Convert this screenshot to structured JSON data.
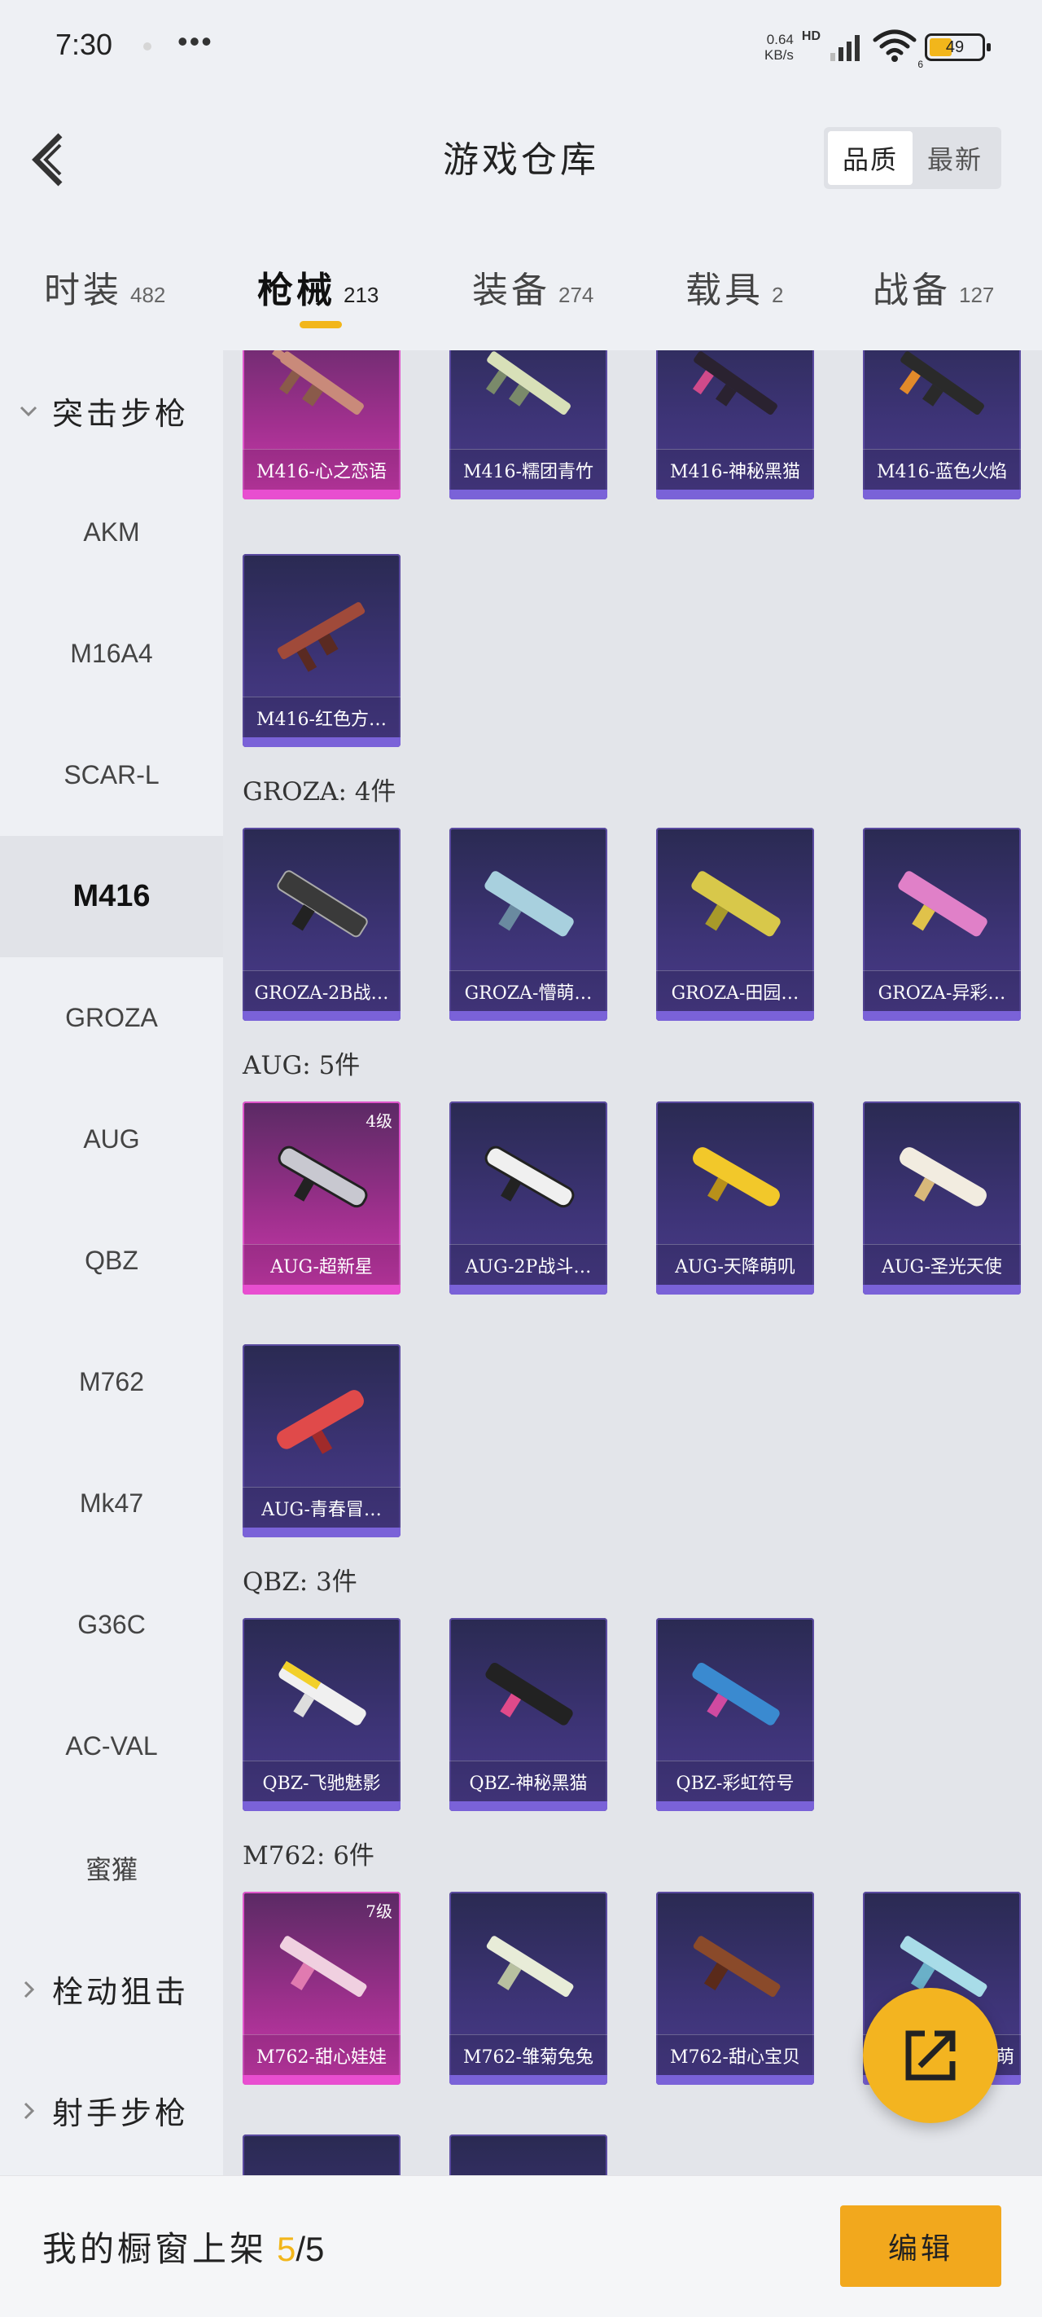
{
  "status_bar": {
    "time": "7:30",
    "more": "•••",
    "net_speed_value": "0.64",
    "net_speed_unit": "KB/s",
    "hd": "HD",
    "wifi_badge": "6",
    "battery": "49",
    "battery_level": 0.49
  },
  "header": {
    "title": "游戏仓库",
    "sort_options": [
      "品质",
      "最新"
    ],
    "sort_active": "品质"
  },
  "tabs": [
    {
      "label": "时装",
      "count": "482"
    },
    {
      "label": "枪械",
      "count": "213"
    },
    {
      "label": "装备",
      "count": "274"
    },
    {
      "label": "载具",
      "count": "2"
    },
    {
      "label": "战备",
      "count": "127"
    }
  ],
  "active_tab": "枪械",
  "sidebar": {
    "group_open": "突击步枪",
    "items": [
      "AKM",
      "M16A4",
      "SCAR-L",
      "M416",
      "GROZA",
      "AUG",
      "QBZ",
      "M762",
      "Mk47",
      "G36C",
      "AC-VAL",
      "蜜獾"
    ],
    "active_item": "M416",
    "groups_collapsed": [
      "栓动狙击",
      "射手步枪"
    ]
  },
  "sections": {
    "m416_partial": [
      {
        "name": "M416-心之恋语",
        "legend": true
      },
      {
        "name": "M416-糯团青竹"
      },
      {
        "name": "M416-神秘黑猫"
      },
      {
        "name": "M416-蓝色火焰"
      },
      {
        "name": "M416-红色方…"
      }
    ],
    "groza": {
      "title": "GROZA: 4件",
      "items": [
        {
          "name": "GROZA-2B战…"
        },
        {
          "name": "GROZA-懵萌…"
        },
        {
          "name": "GROZA-田园…"
        },
        {
          "name": "GROZA-异彩…"
        }
      ]
    },
    "aug": {
      "title": "AUG: 5件",
      "items": [
        {
          "name": "AUG-超新星",
          "legend": true,
          "level": "4级"
        },
        {
          "name": "AUG-2P战斗…"
        },
        {
          "name": "AUG-天降萌叽"
        },
        {
          "name": "AUG-圣光天使"
        },
        {
          "name": "AUG-青春冒…"
        }
      ]
    },
    "qbz": {
      "title": "QBZ: 3件",
      "items": [
        {
          "name": "QBZ-飞驰魅影"
        },
        {
          "name": "QBZ-神秘黑猫"
        },
        {
          "name": "QBZ-彩虹符号"
        }
      ]
    },
    "m762": {
      "title": "M762: 6件",
      "items": [
        {
          "name": "M762-甜心娃娃",
          "legend": true,
          "level": "7级"
        },
        {
          "name": "M762-雏菊兔兔"
        },
        {
          "name": "M762-甜心宝贝"
        },
        {
          "name": "…萌"
        }
      ]
    }
  },
  "bottom_bar": {
    "label": "我的橱窗上架",
    "current": "5",
    "total": "/5",
    "edit_label": "编辑"
  },
  "colors": {
    "accent": "#f2b61b",
    "card_epic": "#4a3c8a",
    "card_legend": "#cc3aae"
  }
}
